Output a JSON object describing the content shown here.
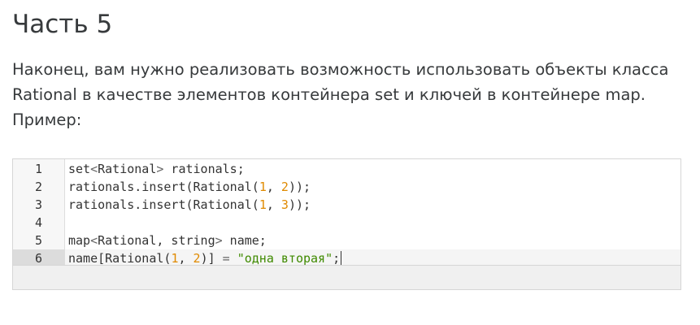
{
  "heading": "Часть 5",
  "paragraph": {
    "lines": [
      "Наконец, вам нужно реализовать возможность использовать объекты класса",
      "Rational в качестве элементов контейнера set и ключей в контейнере map.",
      "Пример:"
    ]
  },
  "code_editor": {
    "active_line": 6,
    "lines": [
      {
        "number": "1",
        "tokens": [
          {
            "t": "set",
            "k": "plain"
          },
          {
            "t": "<",
            "k": "punct"
          },
          {
            "t": "Rational",
            "k": "plain"
          },
          {
            "t": ">",
            "k": "punct"
          },
          {
            "t": " rationals;",
            "k": "plain"
          }
        ]
      },
      {
        "number": "2",
        "tokens": [
          {
            "t": "rationals.insert(Rational(",
            "k": "plain"
          },
          {
            "t": "1",
            "k": "number"
          },
          {
            "t": ", ",
            "k": "plain"
          },
          {
            "t": "2",
            "k": "number"
          },
          {
            "t": "));",
            "k": "plain"
          }
        ]
      },
      {
        "number": "3",
        "tokens": [
          {
            "t": "rationals.insert(Rational(",
            "k": "plain"
          },
          {
            "t": "1",
            "k": "number"
          },
          {
            "t": ", ",
            "k": "plain"
          },
          {
            "t": "3",
            "k": "number"
          },
          {
            "t": "));",
            "k": "plain"
          }
        ]
      },
      {
        "number": "4",
        "tokens": []
      },
      {
        "number": "5",
        "tokens": [
          {
            "t": "map",
            "k": "plain"
          },
          {
            "t": "<",
            "k": "punct"
          },
          {
            "t": "Rational, string",
            "k": "plain"
          },
          {
            "t": ">",
            "k": "punct"
          },
          {
            "t": " name;",
            "k": "plain"
          }
        ]
      },
      {
        "number": "6",
        "tokens": [
          {
            "t": "name[Rational(",
            "k": "plain"
          },
          {
            "t": "1",
            "k": "number"
          },
          {
            "t": ", ",
            "k": "plain"
          },
          {
            "t": "2",
            "k": "number"
          },
          {
            "t": ")] ",
            "k": "plain"
          },
          {
            "t": "=",
            "k": "punct"
          },
          {
            "t": " ",
            "k": "plain"
          },
          {
            "t": "\"одна вторая\"",
            "k": "string"
          },
          {
            "t": ";",
            "k": "plain"
          }
        ]
      }
    ]
  }
}
